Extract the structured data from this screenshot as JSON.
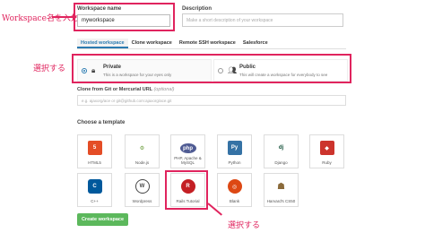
{
  "annotations": {
    "workspace_name_note": "Workspace名を入力",
    "select_privacy_note": "選択する",
    "select_template_note": "選択する"
  },
  "workspace_name": {
    "label": "Workspace name",
    "value": "myworkspace"
  },
  "description": {
    "label": "Description",
    "placeholder": "Make a short description of your workspace"
  },
  "tabs": [
    {
      "label": "Hosted workspace",
      "active": true
    },
    {
      "label": "Clone workspace",
      "active": false
    },
    {
      "label": "Remote SSH workspace",
      "active": false
    },
    {
      "label": "Salesforce",
      "active": false
    }
  ],
  "privacy": {
    "private": {
      "title": "Private",
      "desc": "This is a workspace for your eyes only",
      "selected": true
    },
    "public": {
      "title": "Public",
      "desc": "This will create a workspace for everybody to see",
      "selected": false
    }
  },
  "clone": {
    "label": "Clone from Git or Mercurial URL",
    "optional": "(optional)",
    "placeholder": "e.g. ajaxorg/ace or git@github.com:ajaxorg/ace.git"
  },
  "templates_label": "Choose a template",
  "templates": [
    {
      "name": "HTML5",
      "icon": "html5-icon",
      "color": "#e44d26",
      "glyph": "5"
    },
    {
      "name": "Node.js",
      "icon": "nodejs-icon",
      "color": "#ffffff",
      "glyph": "⚙"
    },
    {
      "name": "PHP, Apache & MySQL",
      "icon": "php-icon",
      "color": "#4f5b93",
      "glyph": "php"
    },
    {
      "name": "Python",
      "icon": "python-icon",
      "color": "#3572a5",
      "glyph": "Py"
    },
    {
      "name": "Django",
      "icon": "django-icon",
      "color": "#ffffff",
      "glyph": "dj"
    },
    {
      "name": "Ruby",
      "icon": "ruby-icon",
      "color": "#cc342d",
      "glyph": "◆"
    },
    {
      "name": "C++",
      "icon": "cpp-icon",
      "color": "#00599c",
      "glyph": "C"
    },
    {
      "name": "Wordpress",
      "icon": "wordpress-icon",
      "color": "#ffffff",
      "glyph": "W"
    },
    {
      "name": "Rails Tutorial",
      "icon": "rails-icon",
      "color": "#c41f24",
      "glyph": "R"
    },
    {
      "name": "Blank",
      "icon": "ubuntu-icon",
      "color": "#dd4814",
      "glyph": "◎"
    },
    {
      "name": "Harvard's CS50",
      "icon": "cs50-icon",
      "color": "#ffffff",
      "glyph": "☗"
    }
  ],
  "create_button": "Create workspace"
}
